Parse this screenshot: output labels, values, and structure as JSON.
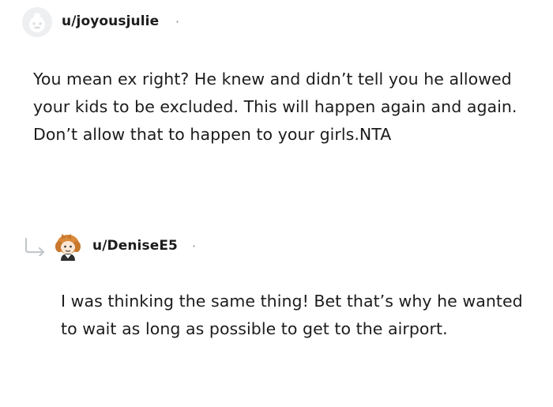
{
  "comment": {
    "username": "u/joyousjulie",
    "separator": "·",
    "text": "You mean ex right? He knew and didn’t tell you he allowed your kids to be excluded. This will happen again and again. Don’t allow that to happen to your girls.NTA"
  },
  "reply": {
    "username": "u/DeniseE5",
    "separator": "·",
    "text": "I was thinking the same thing! Bet that’s why he wanted to wait as long as possible to get to the airport."
  }
}
